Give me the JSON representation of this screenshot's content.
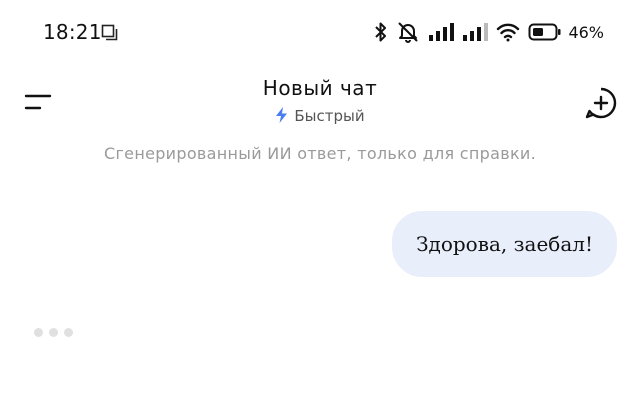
{
  "status_bar": {
    "time": "18:21",
    "battery_percent": "46%",
    "icons": [
      "screen-record-icon",
      "bluetooth-icon",
      "muted-bell-icon",
      "signal-icon",
      "signal-icon",
      "wifi-icon",
      "battery-icon"
    ]
  },
  "header": {
    "title": "Новый чат",
    "mode_label": "Быстрый",
    "mode_icon": "lightning-icon",
    "accent_color": "#4a7df0"
  },
  "disclaimer": "Сгенерированный ИИ ответ, только для справки.",
  "messages": [
    {
      "role": "user",
      "text": "Здорова, заебал!"
    }
  ],
  "typing_indicator": true,
  "colors": {
    "bubble_bg": "#e9eefb",
    "disclaimer_text": "#9a9a9a"
  }
}
